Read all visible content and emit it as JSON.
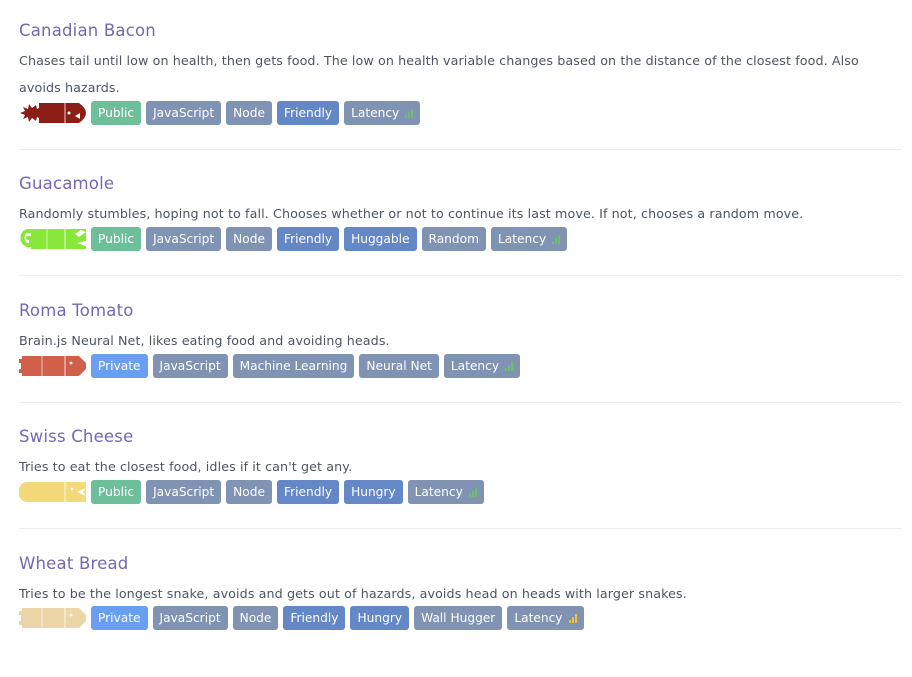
{
  "snakes": [
    {
      "name": "Canadian Bacon",
      "description": "Chases tail until low on health, then gets food. The low on health variable changes based on the distance of the closest food. Also avoids hazards.",
      "color": "#8b1e16",
      "head_icon": "spiky-head-icon",
      "visibility": "Public",
      "tags": [
        "JavaScript",
        "Node",
        "Friendly"
      ],
      "latency_label": "Latency",
      "latency_color": "#6cbf6a"
    },
    {
      "name": "Guacamole",
      "description": "Randomly stumbles, hoping not to fall. Chooses whether or not to continue its last move. If not, chooses a random move.",
      "color": "#88e83a",
      "head_icon": "curly-tail-icon",
      "visibility": "Public",
      "tags": [
        "JavaScript",
        "Node",
        "Friendly",
        "Huggable",
        "Random"
      ],
      "latency_label": "Latency",
      "latency_color": "#6cbf6a"
    },
    {
      "name": "Roma Tomato",
      "description": "Brain.js Neural Net, likes eating food and avoiding heads.",
      "color": "#d0604a",
      "head_icon": "pixel-head-icon",
      "visibility": "Private",
      "tags": [
        "JavaScript",
        "Machine Learning",
        "Neural Net"
      ],
      "latency_label": "Latency",
      "latency_color": "#6cbf6a"
    },
    {
      "name": "Swiss Cheese",
      "description": "Tries to eat the closest food, idles if it can't get any.",
      "color": "#f4d97a",
      "head_icon": "round-head-icon",
      "visibility": "Public",
      "tags": [
        "JavaScript",
        "Node",
        "Friendly",
        "Hungry"
      ],
      "latency_label": "Latency",
      "latency_color": "#6cbf6a"
    },
    {
      "name": "Wheat Bread",
      "description": "Tries to be the longest snake, avoids and gets out of hazards, avoids head on heads with larger snakes.",
      "color": "#ecd6a7",
      "head_icon": "pixel-head-icon",
      "visibility": "Private",
      "tags": [
        "JavaScript",
        "Node",
        "Friendly",
        "Hungry",
        "Wall Hugger"
      ],
      "latency_label": "Latency",
      "latency_color": "#f0c040"
    }
  ]
}
